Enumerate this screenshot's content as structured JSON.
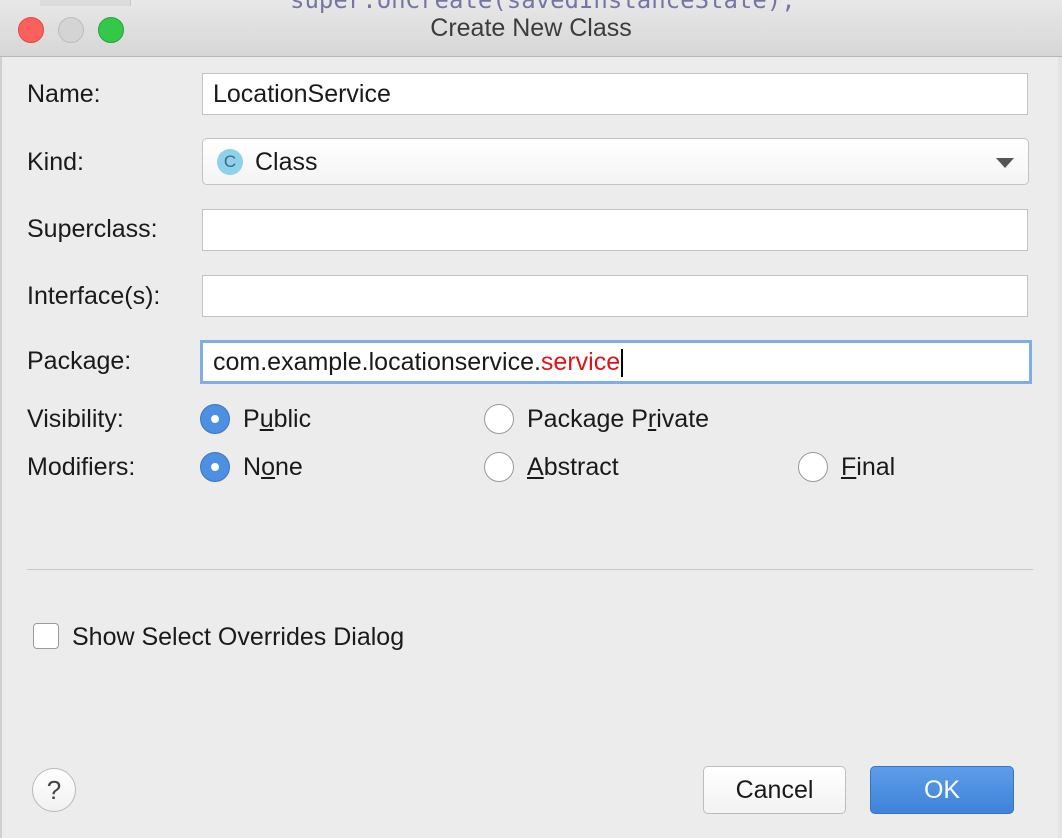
{
  "window": {
    "title": "Create New Class",
    "background_code": "super.onCreate(savedInstanceState);"
  },
  "form": {
    "name": {
      "label": "Name:",
      "value": "LocationService"
    },
    "kind": {
      "label": "Kind:",
      "value": "Class",
      "icon": "class-icon",
      "icon_letter": "C"
    },
    "superclass": {
      "label": "Superclass:",
      "value": ""
    },
    "interfaces": {
      "label": "Interface(s):",
      "value": ""
    },
    "package": {
      "label": "Package:",
      "value_prefix": "com.example.locationservice.",
      "value_highlight": "service",
      "highlight_color": "#e0131b"
    },
    "visibility": {
      "label": "Visibility:",
      "options": [
        {
          "before": "P",
          "mnemonic": "u",
          "after": "blic",
          "selected": true
        },
        {
          "before": "Package P",
          "mnemonic": "r",
          "after": "ivate",
          "selected": false
        }
      ]
    },
    "modifiers": {
      "label": "Modifiers:",
      "options": [
        {
          "before": "N",
          "mnemonic": "o",
          "after": "ne",
          "selected": true
        },
        {
          "before": "",
          "mnemonic": "A",
          "after": "bstract",
          "selected": false
        },
        {
          "before": "",
          "mnemonic": "F",
          "after": "inal",
          "selected": false
        }
      ]
    }
  },
  "overrides_checkbox": {
    "label": "Show Select Overrides Dialog",
    "checked": false
  },
  "footer": {
    "help_label": "?",
    "cancel_label": "Cancel",
    "ok_label": "OK"
  },
  "colors": {
    "accent": "#4d8fe0",
    "ok_button": "#3f82d8",
    "close": "#fc605c",
    "maximize": "#34c84a"
  }
}
